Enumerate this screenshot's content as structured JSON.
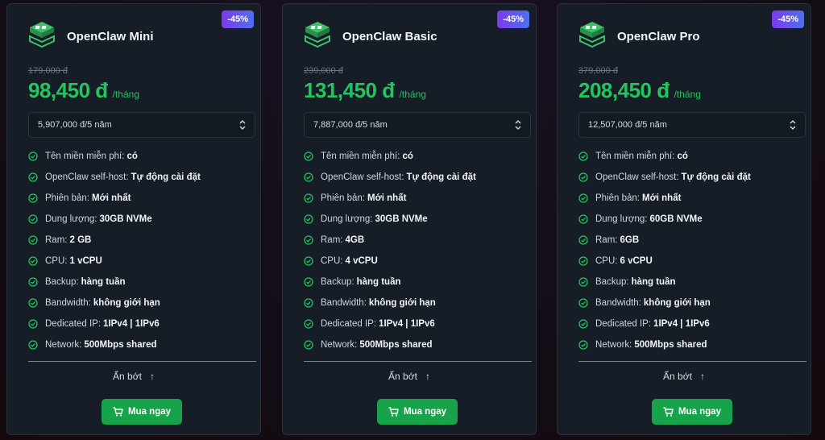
{
  "plans": [
    {
      "badge": "-45%",
      "name": "OpenClaw Mini",
      "old_price": "179,000 đ",
      "price": "98,450 đ",
      "period": "/tháng",
      "term_select": "5,907,000 đ/5 năm",
      "features": [
        {
          "label": "Tên miền miễn phí:",
          "value": "có"
        },
        {
          "label": "OpenClaw self-host:",
          "value": "Tự động cài đặt"
        },
        {
          "label": "Phiên bản:",
          "value": "Mới nhất"
        },
        {
          "label": "Dung lượng:",
          "value": "30GB NVMe"
        },
        {
          "label": "Ram:",
          "value": "2 GB"
        },
        {
          "label": "CPU:",
          "value": "1 vCPU"
        },
        {
          "label": "Backup:",
          "value": "hàng tuần"
        },
        {
          "label": "Bandwidth:",
          "value": "không giới hạn"
        },
        {
          "label": "Dedicated IP:",
          "value": "1IPv4 | 1IPv6"
        },
        {
          "label": "Network:",
          "value": "500Mbps shared"
        }
      ],
      "collapse_label": "Ẩn bớt",
      "buy_label": "Mua ngay"
    },
    {
      "badge": "-45%",
      "name": "OpenClaw Basic",
      "old_price": "239,000 đ",
      "price": "131,450 đ",
      "period": "/tháng",
      "term_select": "7,887,000 đ/5 năm",
      "features": [
        {
          "label": "Tên miền miễn phí:",
          "value": "có"
        },
        {
          "label": "OpenClaw self-host:",
          "value": "Tự động cài đặt"
        },
        {
          "label": "Phiên bản:",
          "value": "Mới nhất"
        },
        {
          "label": "Dung lượng:",
          "value": "30GB NVMe"
        },
        {
          "label": "Ram:",
          "value": "4GB"
        },
        {
          "label": "CPU:",
          "value": "4 vCPU"
        },
        {
          "label": "Backup:",
          "value": "hàng tuần"
        },
        {
          "label": "Bandwidth:",
          "value": "không giới hạn"
        },
        {
          "label": "Dedicated IP:",
          "value": "1IPv4 | 1IPv6"
        },
        {
          "label": "Network:",
          "value": "500Mbps shared"
        }
      ],
      "collapse_label": "Ẩn bớt",
      "buy_label": "Mua ngay"
    },
    {
      "badge": "-45%",
      "name": "OpenClaw Pro",
      "old_price": "379,000 đ",
      "price": "208,450 đ",
      "period": "/tháng",
      "term_select": "12,507,000 đ/5 năm",
      "features": [
        {
          "label": "Tên miền miễn phí:",
          "value": "có"
        },
        {
          "label": "OpenClaw self-host:",
          "value": "Tự động cài đặt"
        },
        {
          "label": "Phiên bản:",
          "value": "Mới nhất"
        },
        {
          "label": "Dung lượng:",
          "value": "60GB NVMe"
        },
        {
          "label": "Ram:",
          "value": "6GB"
        },
        {
          "label": "CPU:",
          "value": "6 vCPU"
        },
        {
          "label": "Backup:",
          "value": "hàng tuần"
        },
        {
          "label": "Bandwidth:",
          "value": "không giới hạn"
        },
        {
          "label": "Dedicated IP:",
          "value": "1IPv4 | 1IPv6"
        },
        {
          "label": "Network:",
          "value": "500Mbps shared"
        }
      ],
      "collapse_label": "Ẩn bớt",
      "buy_label": "Mua ngay"
    }
  ],
  "icons": {
    "logo": "server-box-icon",
    "feature": "check-circle-icon",
    "select": "chevron-up-down-icon",
    "collapse": "arrow-up-icon",
    "buy": "cart-icon"
  },
  "colors": {
    "accent_green": "#22c55e",
    "button_green": "#16a34a",
    "badge_gradient_start": "#7c3aed",
    "badge_gradient_end": "#4f6ff0",
    "card_bg": "#161d27"
  }
}
